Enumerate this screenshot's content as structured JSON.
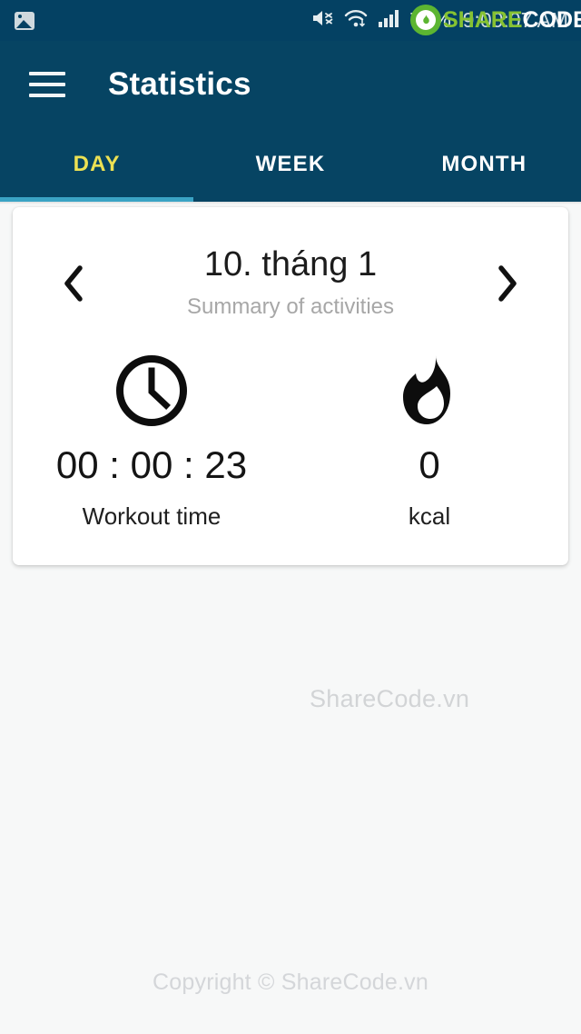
{
  "statusbar": {
    "notification_icon": "photo-icon",
    "mute_icon": "volume-mute-icon",
    "wifi_icon": "wifi-icon",
    "signal_icon": "cellular-signal-icon",
    "battery_percent": "72%",
    "time": "9:00:07 AM",
    "background": "#044163"
  },
  "watermark": {
    "logo_share": "SHARE",
    "logo_code": "CODE",
    "logo_tld": ".vn",
    "inline_text": "ShareCode.vn",
    "footer_text": "Copyright © ShareCode.vn",
    "brand_green": "#86c232"
  },
  "appbar": {
    "menu_icon": "hamburger-menu-icon",
    "title": "Statistics",
    "background": "#064463"
  },
  "tabs": {
    "items": [
      {
        "label": "DAY",
        "active": true
      },
      {
        "label": "WEEK",
        "active": false
      },
      {
        "label": "MONTH",
        "active": false
      }
    ],
    "active_color": "#ece153",
    "indicator_color": "#3aa3c4"
  },
  "card": {
    "prev_icon": "chevron-left-icon",
    "next_icon": "chevron-right-icon",
    "date_title": "10. tháng 1",
    "date_subtitle": "Summary of activities",
    "stats": [
      {
        "icon": "clock-icon",
        "value": "00 : 00 : 23",
        "label": "Workout time"
      },
      {
        "icon": "flame-icon",
        "value": "0",
        "label": "kcal"
      }
    ]
  }
}
